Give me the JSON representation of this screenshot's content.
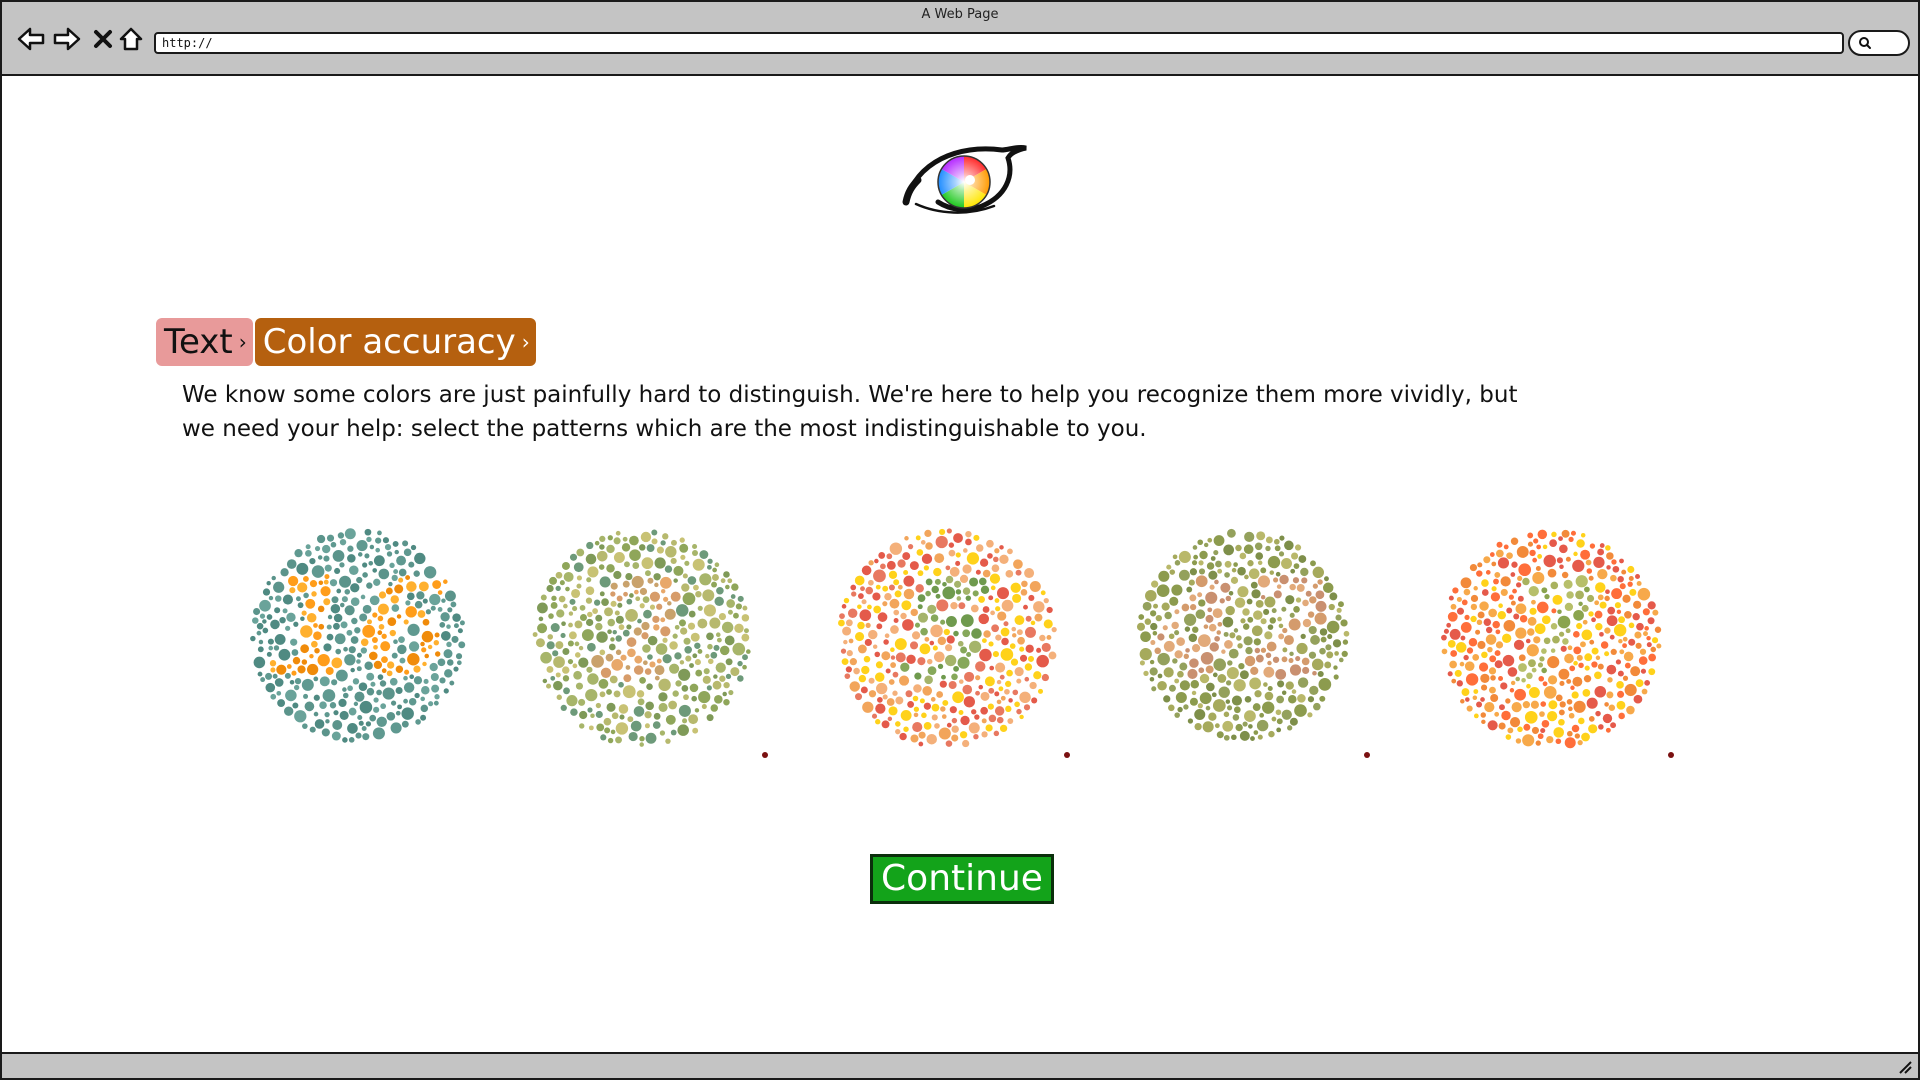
{
  "window": {
    "title": "A Web Page",
    "address": "http://"
  },
  "toolbar": {
    "icons": [
      "back-arrow-icon",
      "forward-arrow-icon",
      "close-x-icon",
      "home-icon",
      "search-icon"
    ]
  },
  "breadcrumb": {
    "items": [
      {
        "label": "Text",
        "color": "#e89a9a"
      },
      {
        "label": "Color accuracy",
        "color": "#b5600f"
      }
    ],
    "separator": "›"
  },
  "intro": {
    "text": "We know some colors are just painfully hard to distinguish. We're here to help you recognize them more vividly, but we need your help: select the patterns which are the most indistinguishable to you."
  },
  "plates": [
    {
      "name": "plate-1",
      "number": "16",
      "bg": [
        "#5f9990",
        "#6aa39a",
        "#4f8a82",
        "#5b948b"
      ],
      "fg": [
        "#ff9d1a",
        "#ffb02e",
        "#f08b0a"
      ],
      "selected": false
    },
    {
      "name": "plate-2",
      "number": "2",
      "bg": [
        "#a7b56a",
        "#8fa65a",
        "#b7b96e",
        "#7f9a58",
        "#c8c274",
        "#6d9a7a"
      ],
      "fg": [
        "#e8a86a",
        "#d79c6a",
        "#c9a26c"
      ],
      "selected": false
    },
    {
      "name": "plate-3",
      "number": "5",
      "bg": [
        "#e87860",
        "#f2a55b",
        "#ffd21a",
        "#e45a4a",
        "#f4b07a"
      ],
      "fg": [
        "#86a85a",
        "#6f9a4e",
        "#a5b46a"
      ],
      "selected": false
    },
    {
      "name": "plate-4",
      "number": "42",
      "bg": [
        "#a6aa5c",
        "#8c9b4e",
        "#b9b86a",
        "#94a15c",
        "#7e8f4a"
      ],
      "fg": [
        "#e2aa7a",
        "#d49b6c",
        "#c99070"
      ],
      "selected": false
    },
    {
      "name": "plate-5",
      "number": "7",
      "bg": [
        "#f28a3a",
        "#ffd21a",
        "#ff6e3a",
        "#e55a4a",
        "#f7a94a"
      ],
      "fg": [
        "#a9b25e",
        "#8aa44e",
        "#b7bf6a"
      ],
      "selected": false
    }
  ],
  "continue": {
    "label": "Continue",
    "color": "#13a31a"
  }
}
